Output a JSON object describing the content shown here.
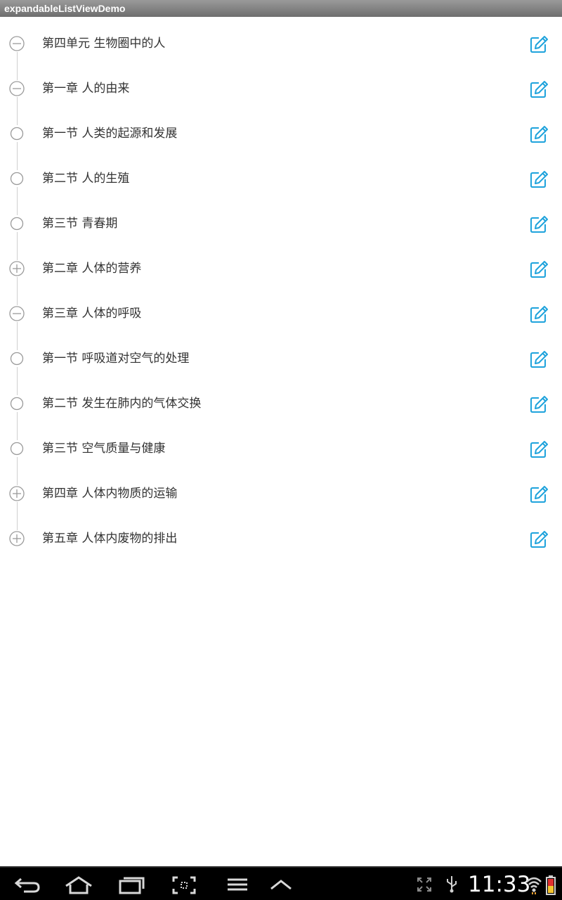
{
  "app_title": "expandableListViewDemo",
  "items": [
    {
      "label": "第四单元  生物圈中的人",
      "state": "collapse"
    },
    {
      "label": "第一章 人的由来",
      "state": "collapse"
    },
    {
      "label": "第一节 人类的起源和发展",
      "state": "leaf"
    },
    {
      "label": "第二节 人的生殖",
      "state": "leaf"
    },
    {
      "label": "第三节 青春期",
      "state": "leaf"
    },
    {
      "label": "第二章 人体的营养",
      "state": "expand"
    },
    {
      "label": "第三章 人体的呼吸",
      "state": "collapse"
    },
    {
      "label": "第一节 呼吸道对空气的处理",
      "state": "leaf"
    },
    {
      "label": "第二节 发生在肺内的气体交换",
      "state": "leaf"
    },
    {
      "label": "第三节 空气质量与健康",
      "state": "leaf"
    },
    {
      "label": "第四章 人体内物质的运输",
      "state": "expand"
    },
    {
      "label": "第五章 人体内废物的排出",
      "state": "expand"
    }
  ],
  "status_bar": {
    "time": "11:33"
  },
  "colors": {
    "accent": "#1fa3dc",
    "indicator": "#9a9a9a",
    "timeline": "#cfcfcf"
  }
}
